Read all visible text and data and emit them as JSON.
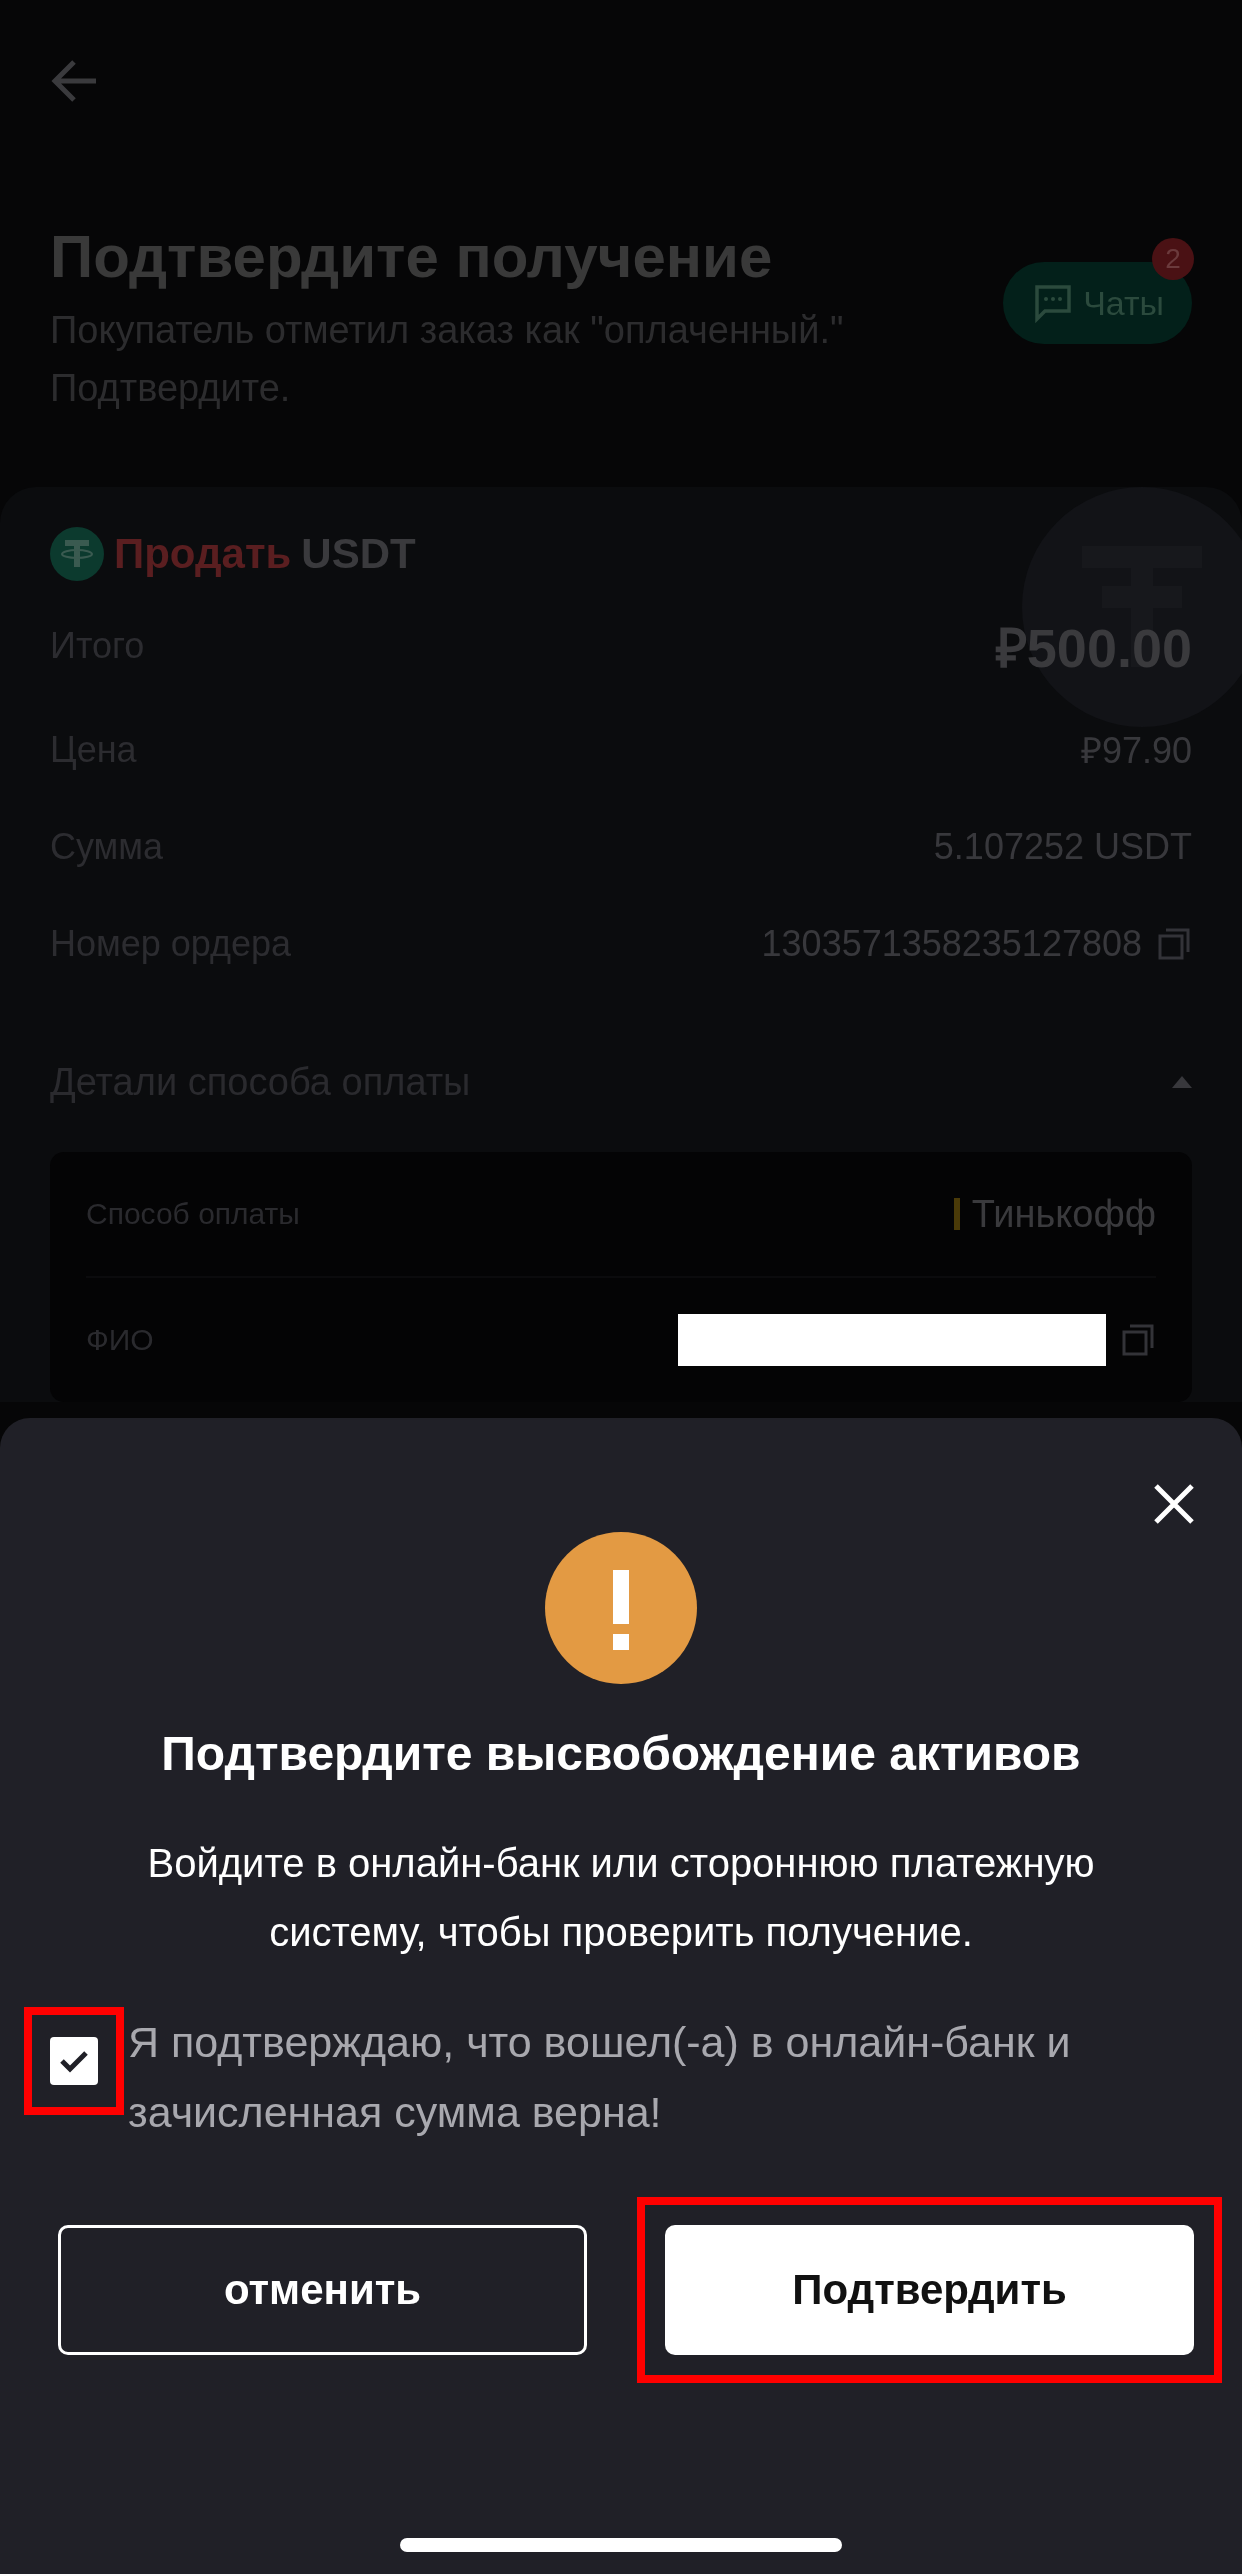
{
  "header": {
    "title": "Подтвердите получение",
    "subtitle": "Покупатель отметил заказ как \"оплаченный.\" Подтвердите.",
    "chats_button": {
      "label": "Чаты",
      "badge": "2"
    }
  },
  "order": {
    "side": "Продать",
    "asset": "USDT",
    "rows": [
      {
        "label": "Итого",
        "value": "₽500.00",
        "kind": "total"
      },
      {
        "label": "Цена",
        "value": "₽97.90",
        "kind": "plain"
      },
      {
        "label": "Сумма",
        "value": "5.107252 USDT",
        "kind": "plain"
      },
      {
        "label": "Номер ордера",
        "value": "1303571358235127808",
        "kind": "copy"
      }
    ]
  },
  "payment_details": {
    "title": "Детали способа оплаты",
    "expanded": true,
    "rows": [
      {
        "label": "Способ оплаты",
        "value": "Тинькофф",
        "kind": "method"
      },
      {
        "label": "ФИО",
        "kind": "redacted"
      }
    ]
  },
  "dialog": {
    "title": "Подтвердите высвобождение активов",
    "message": "Войдите в онлайн-банк или стороннюю платежную систему, чтобы проверить получение.",
    "checkbox": {
      "label": "Я подтверждаю, что вошел(-а) в онлайн-банк и зачисленная сумма верна!",
      "checked": true,
      "highlighted": true
    },
    "buttons": [
      {
        "label": "отменить",
        "kind": "secondary",
        "highlighted": false
      },
      {
        "label": "Подтвердить",
        "kind": "primary",
        "highlighted": true
      }
    ]
  }
}
